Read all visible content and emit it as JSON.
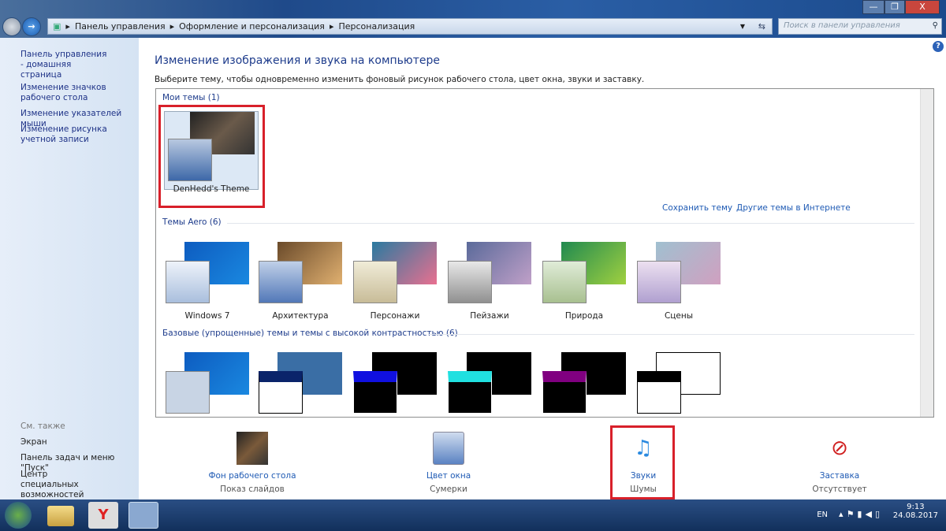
{
  "window": {
    "minimize": "—",
    "maximize": "❐",
    "close": "X"
  },
  "address": {
    "crumbs": [
      "Панель управления",
      "Оформление и персонализация",
      "Персонализация"
    ],
    "search_placeholder": "Поиск в панели управления"
  },
  "sidebar": {
    "links": [
      "Панель управления - домашняя страница",
      "Изменение значков рабочего стола",
      "Изменение указателей мыши",
      "Изменение рисунка учетной записи"
    ],
    "see_also": "См. также",
    "see_links": [
      "Экран",
      "Панель задач и меню \"Пуск\"",
      "Центр специальных возможностей"
    ]
  },
  "main": {
    "title": "Изменение изображения и звука на компьютере",
    "subtitle": "Выберите тему, чтобы одновременно изменить фоновый рисунок рабочего стола, цвет окна, звуки и заставку.",
    "my_themes": {
      "header": "Мои темы (1)",
      "items": [
        "DenHedd's Theme"
      ]
    },
    "save_theme": "Сохранить тему",
    "more_themes": "Другие темы в Интернете",
    "aero": {
      "header": "Темы Aero (6)",
      "items": [
        "Windows 7",
        "Архитектура",
        "Персонажи",
        "Пейзажи",
        "Природа",
        "Сцены"
      ]
    },
    "basic": {
      "header": "Базовые (упрощенные) темы и темы с высокой контрастностью (6)"
    }
  },
  "bottom": [
    {
      "label": "Фон рабочего стола",
      "value": "Показ слайдов"
    },
    {
      "label": "Цвет окна",
      "value": "Сумерки"
    },
    {
      "label": "Звуки",
      "value": "Шумы"
    },
    {
      "label": "Заставка",
      "value": "Отсутствует"
    }
  ],
  "tray": {
    "lang": "EN",
    "time": "9:13",
    "date": "24.08.2017"
  },
  "help": "?"
}
